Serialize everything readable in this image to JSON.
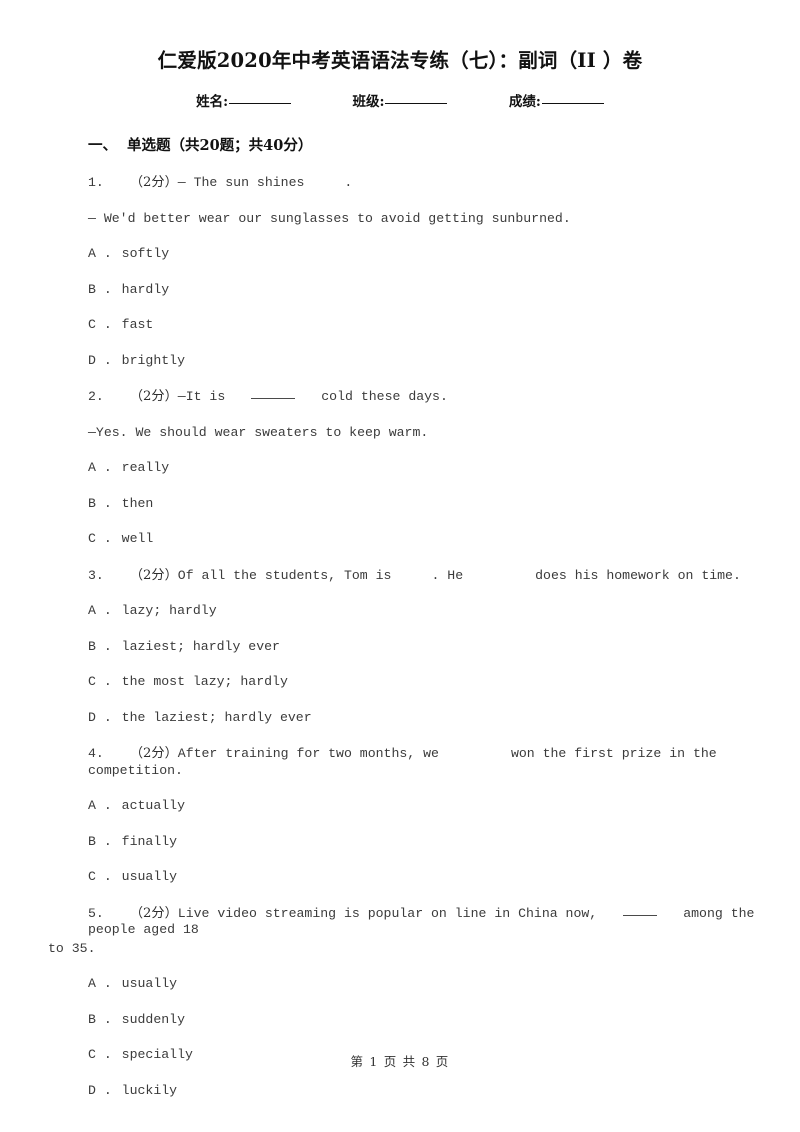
{
  "document": {
    "title": "仁爱版2020年中考英语语法专练（七）：副词（II ）卷",
    "identity": {
      "name_label": "姓名:",
      "class_label": "班级:",
      "score_label": "成绩:"
    },
    "footer": "第 1 页 共 8 页"
  },
  "section": {
    "number": "一、",
    "title": "单选题（共20题；共40分）"
  },
  "questions": [
    {
      "number": "1.",
      "marks": "（2分）",
      "stem": "— The sun shines",
      "stem_trailing": ".",
      "stem_line2": "— We'd better wear our sunglasses to avoid getting sunburned.",
      "options": [
        {
          "label": "A .",
          "text": "softly"
        },
        {
          "label": "B .",
          "text": "hardly"
        },
        {
          "label": "C .",
          "text": "fast"
        },
        {
          "label": "D .",
          "text": "brightly"
        }
      ]
    },
    {
      "number": "2.",
      "marks": "（2分）",
      "stem": "—It is",
      "stem_trailing": "cold these days.",
      "stem_line2": "—Yes. We should wear sweaters to keep warm.",
      "options": [
        {
          "label": "A .",
          "text": "really"
        },
        {
          "label": "B .",
          "text": "then"
        },
        {
          "label": "C .",
          "text": "well"
        }
      ]
    },
    {
      "number": "3.",
      "marks": "（2分）",
      "stem_a": "Of all the students, Tom is",
      "stem_b": ". He",
      "stem_c": "does his homework on time.",
      "options": [
        {
          "label": "A .",
          "text": "lazy; hardly"
        },
        {
          "label": "B .",
          "text": "laziest; hardly ever"
        },
        {
          "label": "C .",
          "text": "the most lazy; hardly"
        },
        {
          "label": "D .",
          "text": "the laziest; hardly ever"
        }
      ]
    },
    {
      "number": "4.",
      "marks": "（2分）",
      "stem_a": "After training for two months, we",
      "stem_b": "won the first prize in the competition.",
      "options": [
        {
          "label": "A .",
          "text": "actually"
        },
        {
          "label": "B .",
          "text": "finally"
        },
        {
          "label": "C .",
          "text": "usually"
        }
      ]
    },
    {
      "number": "5.",
      "marks": "（2分）",
      "stem_a": "Live video streaming is popular on line in China now,",
      "stem_b": "among the people aged 18",
      "stem_tail": "to 35.",
      "options": [
        {
          "label": "A .",
          "text": "usually"
        },
        {
          "label": "B .",
          "text": "suddenly"
        },
        {
          "label": "C .",
          "text": "specially"
        },
        {
          "label": "D .",
          "text": "luckily"
        }
      ]
    }
  ]
}
